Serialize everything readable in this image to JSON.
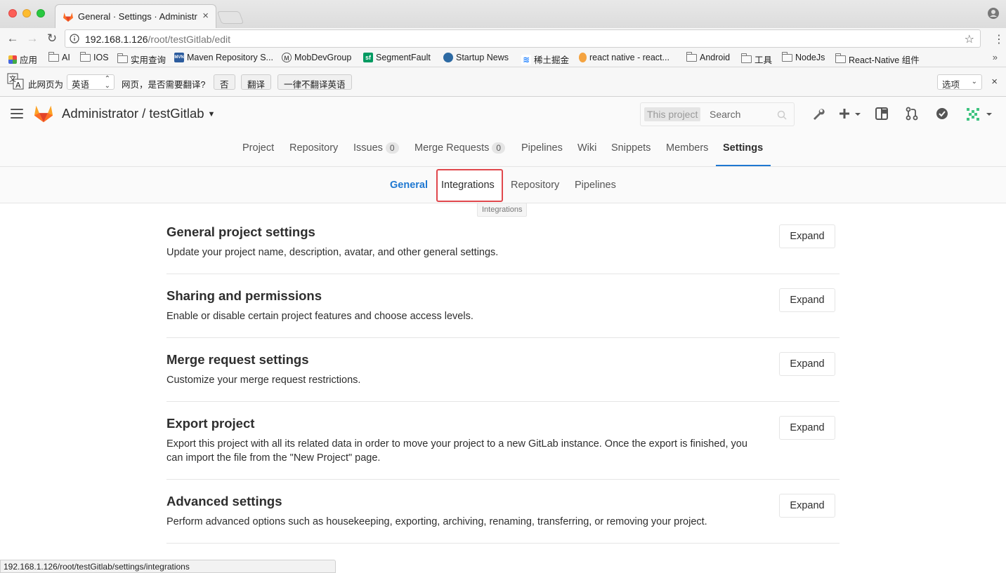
{
  "browser": {
    "tab_title": "General · Settings · Administrator",
    "url_host": "192.168.1.126",
    "url_path": "/root/testGitlab/edit",
    "bookmarks": [
      "应用",
      "AI",
      "IOS",
      "实用查询",
      "Maven Repository S...",
      "MobDevGroup",
      "SegmentFault",
      "Startup News",
      "稀土掘金",
      "react native - react...",
      "Android",
      "工具",
      "NodeJs",
      "React-Native 组件"
    ],
    "bookmarks_more": "»"
  },
  "translate": {
    "page_is": "此网页为",
    "language": "英语",
    "question": "网页，是否需要翻译?",
    "no_btn": "否",
    "translate_btn": "翻译",
    "never_btn": "一律不翻译英语",
    "options": "选项",
    "close": "×"
  },
  "header": {
    "title": "Administrator / testGitlab",
    "search_scope": "This project",
    "search_placeholder": "Search"
  },
  "nav": {
    "project": "Project",
    "repository": "Repository",
    "issues": "Issues",
    "issues_count": "0",
    "merge_requests": "Merge Requests",
    "merge_requests_count": "0",
    "pipelines": "Pipelines",
    "wiki": "Wiki",
    "snippets": "Snippets",
    "members": "Members",
    "settings": "Settings"
  },
  "subnav": {
    "general": "General",
    "integrations": "Integrations",
    "repository": "Repository",
    "pipelines": "Pipelines",
    "tooltip": "Integrations"
  },
  "sections": [
    {
      "title": "General project settings",
      "desc": "Update your project name, description, avatar, and other general settings.",
      "button": "Expand"
    },
    {
      "title": "Sharing and permissions",
      "desc": "Enable or disable certain project features and choose access levels.",
      "button": "Expand"
    },
    {
      "title": "Merge request settings",
      "desc": "Customize your merge request restrictions.",
      "button": "Expand"
    },
    {
      "title": "Export project",
      "desc": "Export this project with all its related data in order to move your project to a new GitLab instance. Once the export is finished, you can import the file from the \"New Project\" page.",
      "button": "Expand"
    },
    {
      "title": "Advanced settings",
      "desc": "Perform advanced options such as housekeeping, exporting, archiving, renaming, transferring, or removing your project.",
      "button": "Expand"
    }
  ],
  "status_url": "192.168.1.126/root/testGitlab/settings/integrations",
  "colors": {
    "accent": "#1f78d1",
    "highlight": "#e0474c",
    "gitlab_orange": "#fc6d26"
  }
}
